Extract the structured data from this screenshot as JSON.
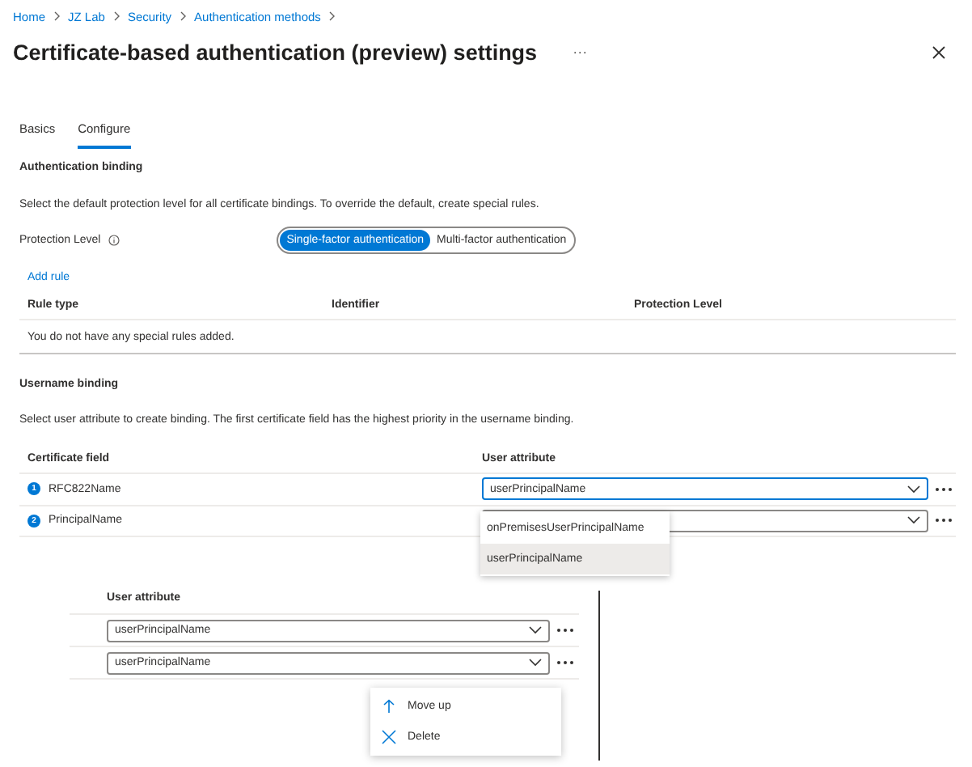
{
  "breadcrumb": [
    "Home",
    "JZ Lab",
    "Security",
    "Authentication methods"
  ],
  "title": "Certificate-based authentication (preview) settings",
  "title_more": "···",
  "tabs": [
    {
      "label": "Basics",
      "selected": false
    },
    {
      "label": "Configure",
      "selected": true
    }
  ],
  "authentication_binding": {
    "heading": "Authentication binding",
    "description": "Select the default protection level for all certificate bindings. To override the default, create special rules.",
    "protection_label": "Protection Level",
    "protection_options": [
      {
        "label": "Single-factor authentication",
        "selected": true
      },
      {
        "label": "Multi-factor authentication",
        "selected": false
      }
    ],
    "add_rule": "Add rule",
    "columns": [
      "Rule type",
      "Identifier",
      "Protection Level"
    ],
    "empty_message": "You do not have any special rules added."
  },
  "username_binding": {
    "heading": "Username binding",
    "description": "Select user attribute to create binding. The first certificate field has the highest priority in the username binding.",
    "columns": [
      "Certificate field",
      "User attribute"
    ],
    "rows": [
      {
        "number": "1",
        "field": "RFC822Name",
        "attribute": "userPrincipalName",
        "focused": true
      },
      {
        "number": "2",
        "field": "PrincipalName",
        "attribute": "",
        "focused": false
      }
    ],
    "dropdown_options": [
      {
        "label": "onPremisesUserPrincipalName",
        "selected": false
      },
      {
        "label": "userPrincipalName",
        "selected": true
      }
    ]
  },
  "inset": {
    "column": "User attribute",
    "rows": [
      {
        "attribute": "userPrincipalName"
      },
      {
        "attribute": "userPrincipalName"
      }
    ],
    "menu": [
      {
        "kind": "up",
        "label": "Move up"
      },
      {
        "kind": "delete",
        "label": "Delete"
      }
    ]
  }
}
